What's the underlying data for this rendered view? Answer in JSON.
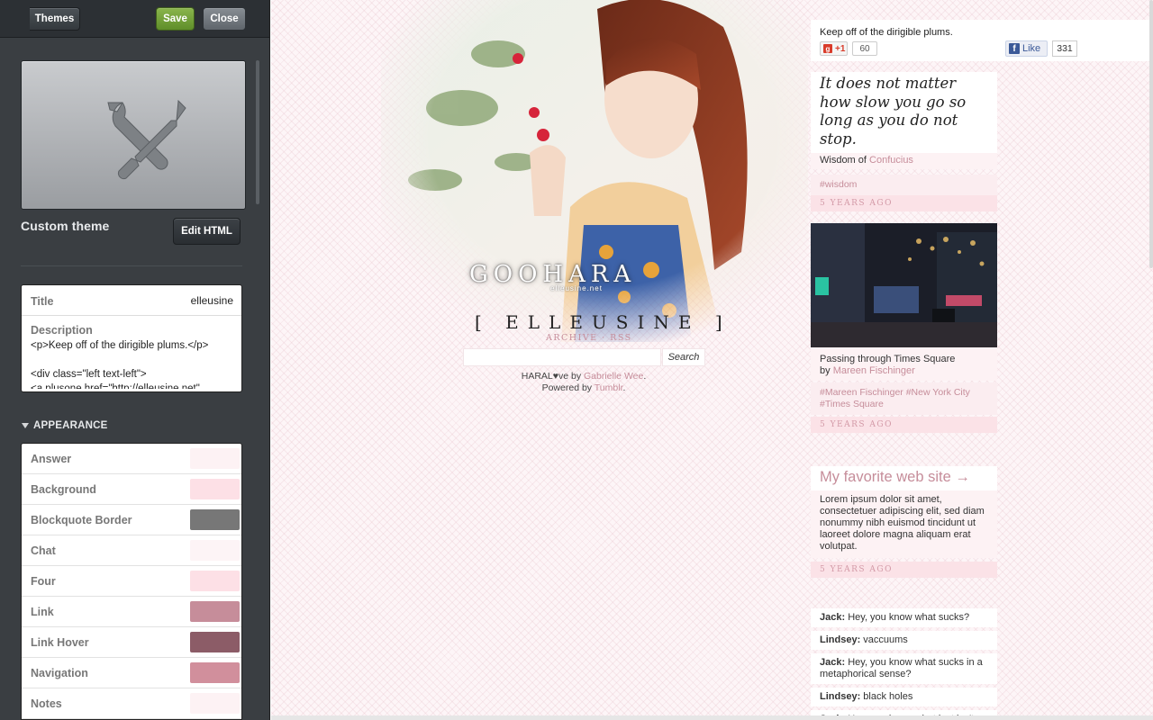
{
  "sidebar": {
    "themes_button": "Themes",
    "save_button": "Save",
    "close_button": "Close",
    "theme_name": "Custom theme",
    "edit_html_button": "Edit HTML",
    "title_label": "Title",
    "title_value": "elleusine",
    "description_label": "Description",
    "description_value": "<p>Keep off of the dirigible plums.</p>\n\n<div class=\"left text-left\">\n<a plusone href=\"http://elleusine.net\"",
    "appearance_heading": "APPEARANCE",
    "appearance_items": [
      {
        "label": "Answer",
        "color": "#fdf2f4"
      },
      {
        "label": "Background",
        "color": "#fde0e6"
      },
      {
        "label": "Blockquote Border",
        "color": "#777777"
      },
      {
        "label": "Chat",
        "color": "#fdf4f6"
      },
      {
        "label": "Four",
        "color": "#fde0e6"
      },
      {
        "label": "Link",
        "color": "#c68d9a"
      },
      {
        "label": "Link Hover",
        "color": "#8c5c67"
      },
      {
        "label": "Navigation",
        "color": "#d18f9c"
      },
      {
        "label": "Notes",
        "color": "#fdf2f4"
      }
    ]
  },
  "blog": {
    "header_name": "GOOHARA",
    "header_sub": "elleusine.net",
    "title": "[ ELLEUSINE ]",
    "nav_links": "ARCHIVE · RSS",
    "search_button": "Search",
    "credits_line1_prefix": "HARAL♥ve by ",
    "credits_author": "Gabrielle Wee",
    "credits_line1_suffix": ".",
    "credits_line2_prefix": "Powered by ",
    "credits_platform": "Tumblr",
    "credits_line2_suffix": "."
  },
  "description_box": {
    "text": "Keep off of the dirigible plums.",
    "gplus_label": "+1",
    "gplus_count": "60",
    "fb_label": "Like",
    "fb_count": "331"
  },
  "posts": {
    "quote": {
      "text": "It does not matter how slow you go so long as you do not stop.",
      "source_prefix": "Wisdom of ",
      "source_link": "Confucius",
      "tags": "#wisdom",
      "date": "5 YEARS AGO"
    },
    "photo": {
      "caption_line1": "Passing through Times Square",
      "caption_by": "by ",
      "caption_author": "Mareen Fischinger",
      "tags": "#Mareen Fischinger  #New York City  #Times Square",
      "date": "5 YEARS AGO"
    },
    "link": {
      "title": "My favorite web site →",
      "body": "Lorem ipsum dolor sit amet, consectetuer adipiscing elit, sed diam nonummy nibh euismod tincidunt ut laoreet dolore magna aliquam erat volutpat.",
      "date": "5 YEARS AGO"
    },
    "chat": {
      "lines": [
        {
          "speaker": "Jack:",
          "text": " Hey, you know what sucks?"
        },
        {
          "speaker": "Lindsey:",
          "text": " vaccuums"
        },
        {
          "speaker": "Jack:",
          "text": " Hey, you know what sucks in a metaphorical sense?"
        },
        {
          "speaker": "Lindsey:",
          "text": " black holes"
        },
        {
          "speaker": "Jack:",
          "text": " Hey, you know what just isn't"
        }
      ]
    }
  }
}
